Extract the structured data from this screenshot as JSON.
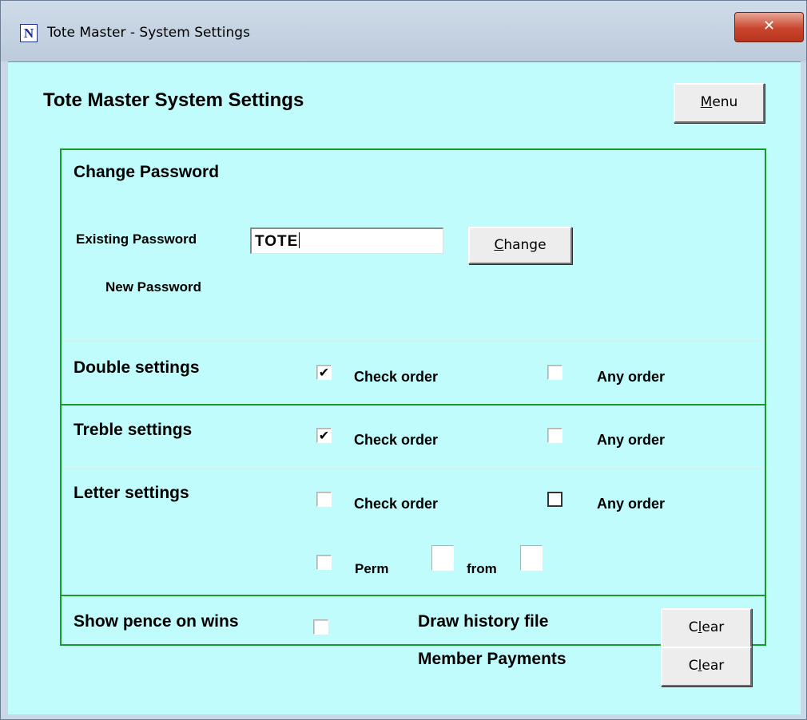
{
  "window": {
    "icon_letter": "N",
    "title": "Tote Master - System Settings",
    "close_glyph": "✕"
  },
  "heading": "Tote Master System Settings",
  "menu_button": {
    "prefix": "",
    "mnemonic": "M",
    "rest": "enu"
  },
  "password": {
    "section_title": "Change Password",
    "existing_label": "Existing Password",
    "existing_value": "TOTE",
    "new_label": "New Password",
    "change_button": {
      "prefix": "",
      "mnemonic": "C",
      "rest": "hange"
    }
  },
  "double": {
    "title": "Double settings",
    "check_order": {
      "label": "Check order",
      "checked": true
    },
    "any_order": {
      "label": "Any order",
      "checked": false
    }
  },
  "treble": {
    "title": "Treble settings",
    "check_order": {
      "label": "Check order",
      "checked": true
    },
    "any_order": {
      "label": "Any order",
      "checked": false
    }
  },
  "letter": {
    "title": "Letter settings",
    "check_order": {
      "label": "Check order",
      "checked": false
    },
    "any_order": {
      "label": "Any order",
      "checked": false
    },
    "perm": {
      "label": "Perm",
      "checked": false
    },
    "from_label": "from"
  },
  "footer": {
    "show_pence_label": "Show pence on wins",
    "show_pence_checked": false,
    "draw_history_label": "Draw history file",
    "member_payments_label": "Member Payments",
    "clear_button": {
      "prefix": "C",
      "mnemonic": "l",
      "rest": "ear"
    }
  },
  "colors": {
    "client_background": "#c0fcfc",
    "group_border": "#1a9a2a",
    "close_button": "#c9452d"
  },
  "icons": {
    "app": "app-icon",
    "close": "close-icon",
    "check": "check-mark-icon"
  }
}
